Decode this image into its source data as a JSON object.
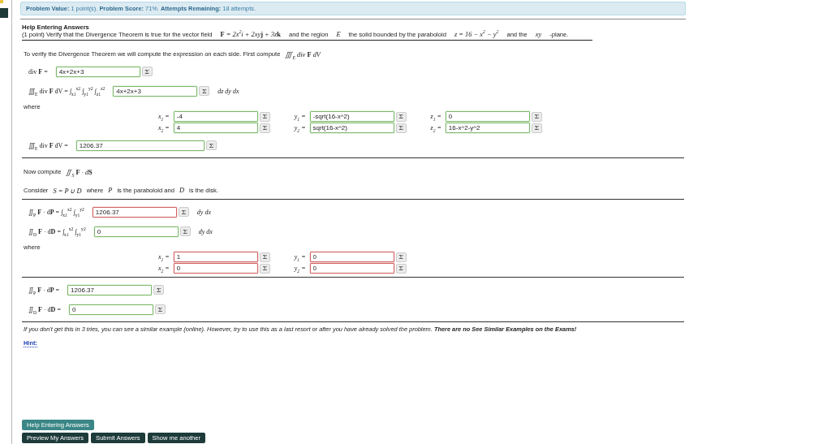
{
  "problem_info": "**Problem Value:** 1 point(s). **Problem Score:** 71%. **Attempts Remaining:** 18 attempts.",
  "help_heading": "Help Entering Answers",
  "statement": [
    {
      "kind": "text",
      "text": "(1 point) Verify that the Divergence Theorem is true for the vector field"
    },
    {
      "kind": "math",
      "text": "**F** = 2x$^{2}$i + 2xy**j** + 3z**k**"
    },
    {
      "kind": "text",
      "text": "and the region"
    },
    {
      "kind": "math",
      "text": "E"
    },
    {
      "kind": "text",
      "text": "the solid bounded by the paraboloid"
    },
    {
      "kind": "math",
      "text": "z = 16 − x$^{2}$ − y$^{2}$"
    },
    {
      "kind": "text",
      "text": "and the"
    },
    {
      "kind": "math",
      "text": "xy"
    },
    {
      "kind": "text",
      "text": "-plane."
    }
  ],
  "blocks": [
    {
      "kind": "prompt",
      "parts": [
        {
          "kind": "text",
          "text": "To verify the Divergence Theorem we will compute the expression on each side. First compute"
        },
        {
          "kind": "math",
          "text": "∭$_{E}$ div **F** dV"
        }
      ]
    },
    {
      "kind": "answer",
      "label": "div **F** =",
      "value": "4x+2x+3",
      "correct": true,
      "button": "Σ"
    },
    {
      "kind": "answer",
      "label": "∭$_{E}$ div **F** dV = ∫$_{x1}$$^{x2}$ ∫$_{y1}$$^{y2}$ ∫$_{z1}$$^{z2}$",
      "value": "4x+2x+3",
      "correct": true,
      "button": "Σ",
      "suffix": "dz dy dx"
    },
    {
      "kind": "limits",
      "label": "where",
      "columns": [
        [
          {
            "label": "x$_{1}$ =",
            "value": "-4",
            "correct": true,
            "button": "Σ"
          },
          {
            "label": "x$_{2}$ =",
            "value": "4",
            "correct": true,
            "button": "Σ"
          }
        ],
        [
          {
            "label": "y$_{1}$ =",
            "value": "-sqrt(16-x^2)",
            "correct": true,
            "button": "Σ"
          },
          {
            "label": "y$_{2}$ =",
            "value": "sqrt(16-x^2)",
            "correct": true,
            "button": "Σ"
          }
        ],
        [
          {
            "label": "z$_{1}$ =",
            "value": "0",
            "correct": true,
            "button": "Σ"
          },
          {
            "label": "z$_{2}$ =",
            "value": "16-x^2-y^2",
            "correct": true,
            "button": "Σ"
          }
        ]
      ]
    },
    {
      "kind": "answer",
      "label": "∭$_{E}$ div **F** dV =",
      "value": "1206.37",
      "correct": true,
      "button": "Σ",
      "wide": true
    },
    {
      "kind": "divider"
    },
    {
      "kind": "prompt",
      "parts": [
        {
          "kind": "text",
          "text": "Now compute"
        },
        {
          "kind": "math",
          "text": "∬$_{S}$ **F** · d**S**"
        }
      ]
    },
    {
      "kind": "prompt",
      "parts": [
        {
          "kind": "text",
          "text": "Consider"
        },
        {
          "kind": "math",
          "text": "S = P ∪ D"
        },
        {
          "kind": "text",
          "text": "where"
        },
        {
          "kind": "math",
          "text": "P"
        },
        {
          "kind": "text",
          "text": "is the paraboloid and"
        },
        {
          "kind": "math",
          "text": "D"
        },
        {
          "kind": "text",
          "text": "is the disk."
        }
      ]
    },
    {
      "kind": "divider"
    },
    {
      "kind": "answer",
      "label": "∬$_{P}$ **F** · d**P** = ∫$_{x1}$$^{x2}$ ∫$_{y1}$$^{y2}$",
      "value": "1206.37",
      "correct": false,
      "button": "Σ",
      "suffix": "dy dx"
    },
    {
      "kind": "answer",
      "label": "∬$_{D}$ **F** · d**D** = ∫$_{x1}$$^{x2}$ ∫$_{y1}$$^{y2}$",
      "value": "0",
      "correct": true,
      "button": "Σ",
      "suffix": "dy dx"
    },
    {
      "kind": "limits",
      "label": "where",
      "columns": [
        [
          {
            "label": "x$_{1}$ =",
            "value": "1",
            "correct": false,
            "button": "Σ"
          },
          {
            "label": "x$_{2}$ =",
            "value": "0",
            "correct": false,
            "button": "Σ"
          }
        ],
        [
          {
            "label": "y$_{1}$ =",
            "value": "0",
            "correct": false,
            "button": "Σ"
          },
          {
            "label": "y$_{2}$ =",
            "value": "0",
            "correct": false,
            "button": "Σ"
          }
        ]
      ]
    },
    {
      "kind": "divider"
    },
    {
      "kind": "answer",
      "label": "∬$_{P}$ **F** · d**P** =",
      "value": "1206.37",
      "correct": true,
      "button": "Σ"
    },
    {
      "kind": "answer",
      "label": "∬$_{D}$ **F** · d**D** =",
      "value": "0",
      "correct": true,
      "button": "Σ"
    },
    {
      "kind": "divider"
    },
    {
      "kind": "note",
      "text": "If you don't get this in 3 tries, you can see a similar example (online). However, try to use this as a last resort or after you have already solved the problem. **There are no See Similar Examples on the Exams!**"
    },
    {
      "kind": "hint",
      "text": "Hint:"
    }
  ],
  "help_button": "Help Entering Answers",
  "buttons": [
    "Preview My Answers",
    "Submit Answers",
    "Show me another"
  ]
}
